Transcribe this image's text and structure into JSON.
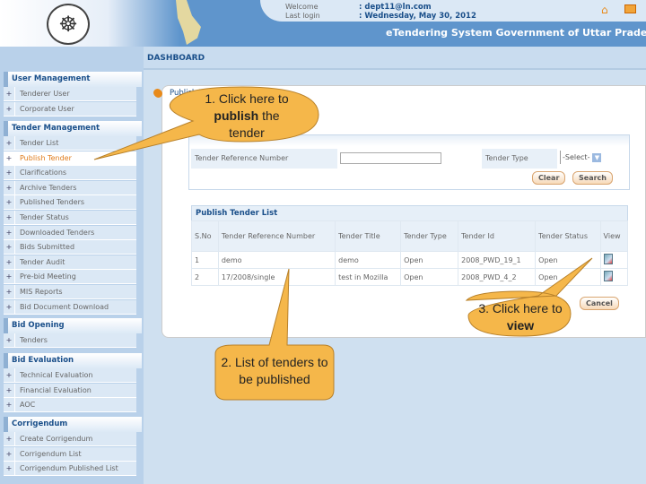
{
  "header": {
    "welcome_label": "Welcome",
    "welcome_value": ": dept11@ln.com",
    "lastlogin_label": "Last login",
    "lastlogin_value": ": Wednesday, May 30, 2012",
    "system_title": "eTendering System Government of Uttar Pradesh",
    "icons": [
      "home-icon",
      "profile-card-icon"
    ]
  },
  "dashboard": {
    "title": "DASHBOARD"
  },
  "sidebar": {
    "sections": [
      {
        "title": "User Management",
        "items": [
          "Tenderer User",
          "Corporate User"
        ]
      },
      {
        "title": "Tender Management",
        "items": [
          "Tender List",
          "Publish Tender",
          "Clarifications",
          "Archive Tenders",
          "Published Tenders",
          "Tender Status",
          "Downloaded Tenders",
          "Bids Submitted",
          "Tender Audit",
          "Pre-bid Meeting",
          "MIS Reports",
          "Bid Document Download"
        ]
      },
      {
        "title": "Bid Opening",
        "items": [
          "Tenders"
        ]
      },
      {
        "title": "Bid Evaluation",
        "items": [
          "Technical Evaluation",
          "Financial Evaluation",
          "AOC"
        ]
      },
      {
        "title": "Corrigendum",
        "items": [
          "Create Corrigendum",
          "Corrigendum List",
          "Corrigendum Published List"
        ]
      }
    ],
    "active_item": "Publish Tender",
    "active_color": "#e07b1a"
  },
  "main": {
    "page_heading": "Publish Tender",
    "search": {
      "ref_label": "Tender Reference Number",
      "ref_value": "",
      "type_label": "Tender Type",
      "type_value": "-Select-",
      "clear": "Clear",
      "search": "Search"
    },
    "table": {
      "caption": "Publish Tender List",
      "headers": [
        "S.No",
        "Tender Reference Number",
        "Tender Title",
        "Tender Type",
        "Tender Id",
        "Tender Status",
        "View"
      ],
      "rows": [
        [
          "1",
          "demo",
          "demo",
          "Open",
          "2008_PWD_19_1",
          "Open"
        ],
        [
          "2",
          "17/2008/single",
          "test in Mozilla",
          "Open",
          "2008_PWD_4_2",
          "Open"
        ]
      ]
    },
    "cancel": "Cancel"
  },
  "callouts": {
    "c1a": "1. Click here to",
    "c1b": "publish",
    "c1c": " the",
    "c1d": "tender",
    "c2": "2. List of tenders to be published",
    "c3a": "3. Click here to",
    "c3b": "view",
    "color": "#f5b74a"
  }
}
